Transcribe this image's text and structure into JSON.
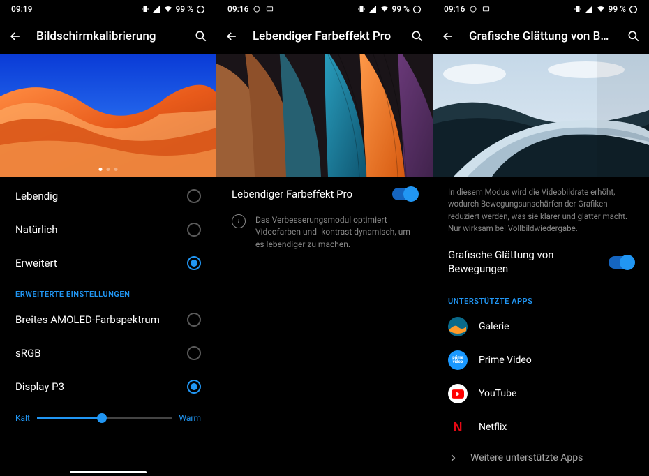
{
  "status": {
    "time1": "09:19",
    "time2": "09:16",
    "time3": "09:16",
    "battery": "99 %"
  },
  "screen1": {
    "title": "Bildschirmkalibrierung",
    "radios": [
      {
        "label": "Lebendig",
        "selected": false
      },
      {
        "label": "Natürlich",
        "selected": false
      },
      {
        "label": "Erweitert",
        "selected": true
      }
    ],
    "section": "ERWEITERTE EINSTELLUNGEN",
    "radios2": [
      {
        "label": "Breites AMOLED-Farbspektrum",
        "selected": false
      },
      {
        "label": "sRGB",
        "selected": false
      },
      {
        "label": "Display P3",
        "selected": true
      }
    ],
    "slider_left": "Kalt",
    "slider_right": "Warm"
  },
  "screen2": {
    "title": "Lebendiger Farbeffekt Pro",
    "toggle_label": "Lebendiger Farbeffekt Pro",
    "desc": "Das Verbesserungsmodul optimiert Videofarben und -kontrast dynamisch, um es lebendiger zu machen."
  },
  "screen3": {
    "title": "Grafische Glättung von Bewegu…",
    "desc": "In diesem Modus wird die Videobildrate erhöht, wodurch Bewegungsunschärfen der Grafiken reduziert werden, was sie klarer und glatter macht. Nur wirksam bei Vollbildwiedergabe.",
    "toggle_label": "Grafische Glättung von Bewegungen",
    "apps_header": "UNTERSTÜTZTE APPS",
    "apps": [
      {
        "label": "Galerie"
      },
      {
        "label": "Prime Video"
      },
      {
        "label": "YouTube"
      },
      {
        "label": "Netflix"
      }
    ],
    "more": "Weitere unterstützte Apps"
  }
}
